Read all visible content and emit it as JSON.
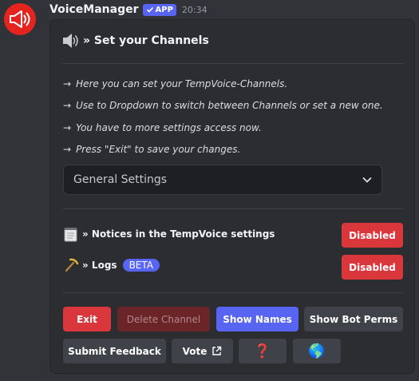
{
  "message": {
    "author": "VoiceManager",
    "badge": "APP",
    "timestamp": "20:34"
  },
  "embed": {
    "title": "» Set your Channels",
    "lines": [
      "Here you can set your TempVoice-Channels.",
      "Use to Dropdown to switch between Channels or set a new one.",
      "You have to more settings access now.",
      "Press \"Exit\" to save your changes."
    ],
    "arrow": "→",
    "dropdown_value": "General Settings",
    "settings": [
      {
        "label": "» Notices in the TempVoice settings",
        "button": "Disabled",
        "icon": "notepad-icon"
      },
      {
        "label": "» Logs",
        "tag": "BETA",
        "button": "Disabled",
        "icon": "pickaxe-icon"
      }
    ]
  },
  "buttons": {
    "exit": "Exit",
    "delete_channel": "Delete Channel",
    "show_names": "Show Names",
    "show_bot_perms": "Show Bot Perms",
    "submit_feedback": "Submit Feedback",
    "vote": "Vote",
    "help": "❓",
    "globe": "🌎"
  },
  "colors": {
    "background": "#313338",
    "embed": "#2b2d31",
    "blurple": "#5865f2",
    "danger": "#da373c",
    "secondary": "#404249"
  }
}
